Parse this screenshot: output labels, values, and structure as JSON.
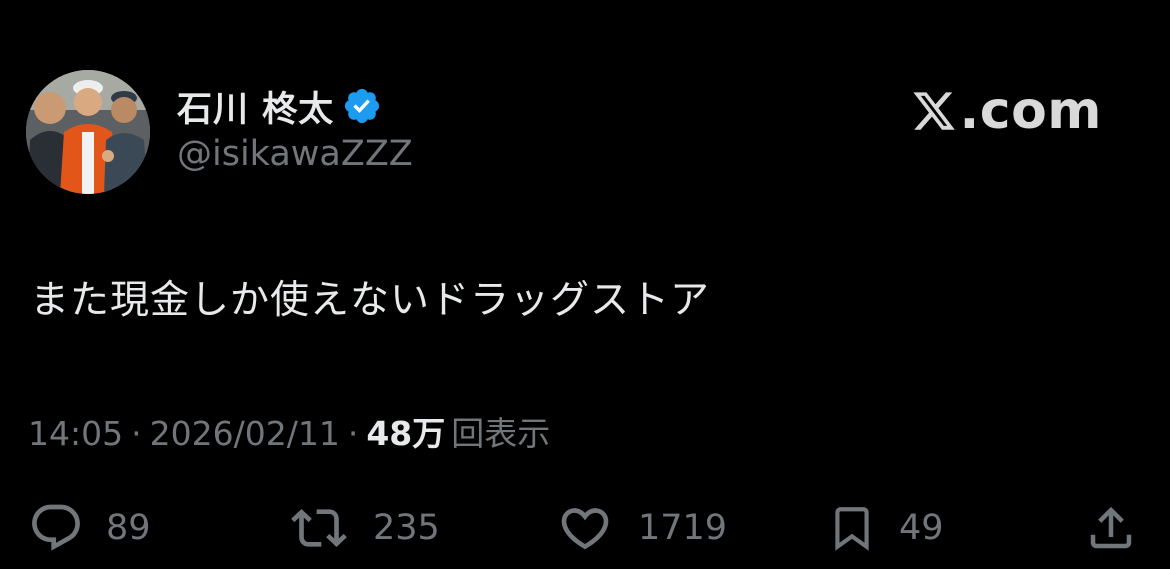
{
  "author": {
    "display_name": "石川 柊太",
    "handle": "@isikawaZZZ",
    "verified": true,
    "verified_color": "#1d9bf0"
  },
  "site": {
    "logo_text": ".com",
    "logo_mark": "x-logo-icon"
  },
  "tweet": {
    "text": "また現金しか使えないドラッグストア",
    "time": "14:05",
    "separator": "·",
    "date": "2026/02/11",
    "views_count": "48万",
    "views_label": "回表示"
  },
  "actions": {
    "reply": {
      "icon": "reply-icon",
      "count": "89"
    },
    "retweet": {
      "icon": "retweet-icon",
      "count": "235"
    },
    "like": {
      "icon": "heart-icon",
      "count": "1719"
    },
    "bookmark": {
      "icon": "bookmark-icon",
      "count": "49"
    },
    "share": {
      "icon": "share-icon"
    }
  },
  "colors": {
    "background": "#000000",
    "primary_text": "#e7e9ea",
    "secondary_text": "#71767b"
  }
}
